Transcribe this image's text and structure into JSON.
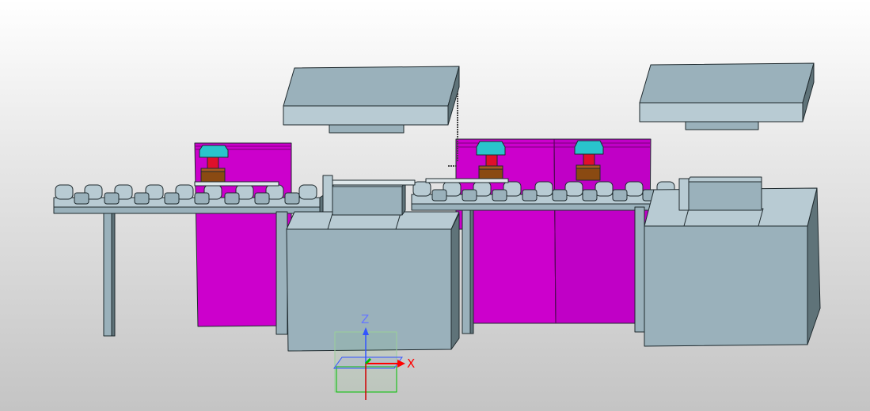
{
  "viewport": {
    "background_top": "#ffffff",
    "background_bottom": "#c4c4c4"
  },
  "colors": {
    "machine_body": "#9ab1bb",
    "machine_top": "#b8cbd3",
    "machine_dark": "#5f7379",
    "outline": "#1f2a2e",
    "magenta_panel": "#cc00cc",
    "magenta_dark": "#a800a8",
    "clamp_cyan": "#29c4cc",
    "rod_red": "#e0102a",
    "block_brown": "#8a4a12",
    "axis_x": "#ff0000",
    "axis_y": "#00c000",
    "axis_z": "#3355ff"
  },
  "triad": {
    "x_label": "X",
    "z_label": "Z"
  }
}
